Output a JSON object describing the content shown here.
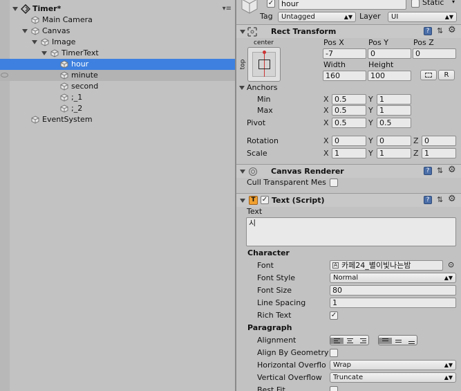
{
  "hierarchy": {
    "scene_title": "Timer*",
    "scene_menu": "▾≡",
    "rows": [
      {
        "label": "Main Camera"
      },
      {
        "label": "Canvas"
      },
      {
        "label": "Image"
      },
      {
        "label": "TimerText"
      },
      {
        "label": "hour"
      },
      {
        "label": "minute"
      },
      {
        "label": "second"
      },
      {
        "label": ";_1"
      },
      {
        "label": ";_2"
      },
      {
        "label": "EventSystem"
      }
    ]
  },
  "inspector": {
    "object_name": "hour",
    "static_label": "Static",
    "tag_label": "Tag",
    "tag_value": "Untagged",
    "layer_label": "Layer",
    "layer_value": "UI",
    "rect": {
      "title": "Rect Transform",
      "anchor_preset_top": "center",
      "anchor_preset_side": "top",
      "pos_x_label": "Pos X",
      "pos_y_label": "Pos Y",
      "pos_z_label": "Pos Z",
      "pos_x": "-7",
      "pos_y": "0",
      "pos_z": "0",
      "width_label": "Width",
      "height_label": "Height",
      "width": "160",
      "height": "100",
      "r_button": "R",
      "anchors_label": "Anchors",
      "min_label": "Min",
      "max_label": "Max",
      "min_x": "0.5",
      "min_y": "1",
      "max_x": "0.5",
      "max_y": "1",
      "pivot_label": "Pivot",
      "pivot_x": "0.5",
      "pivot_y": "0.5",
      "rotation_label": "Rotation",
      "rot_x": "0",
      "rot_y": "0",
      "rot_z": "0",
      "scale_label": "Scale",
      "scale_x": "1",
      "scale_y": "1",
      "scale_z": "1",
      "x": "X",
      "y": "Y",
      "z": "Z"
    },
    "canvas_renderer": {
      "title": "Canvas Renderer",
      "cull_label": "Cull Transparent Mes"
    },
    "text_script": {
      "title": "Text (Script)",
      "text_label": "Text",
      "text_value": "시",
      "character_label": "Character",
      "font_label": "Font",
      "font_value": "카페24_별이빛나는밤",
      "font_style_label": "Font Style",
      "font_style_value": "Normal",
      "font_size_label": "Font Size",
      "font_size_value": "80",
      "line_spacing_label": "Line Spacing",
      "line_spacing_value": "1",
      "rich_text_label": "Rich Text",
      "paragraph_label": "Paragraph",
      "alignment_label": "Alignment",
      "align_geometry_label": "Align By Geometry",
      "h_overflow_label": "Horizontal Overflo",
      "h_overflow_value": "Wrap",
      "v_overflow_label": "Vertical Overflow",
      "v_overflow_value": "Truncate",
      "best_fit_label": "Best Fit"
    }
  },
  "colors": {
    "panel_bg": "#c2c2c2",
    "selection": "#3d80df",
    "field_bg": "#e9e9e9",
    "help_icon": "#4b6ea8"
  }
}
